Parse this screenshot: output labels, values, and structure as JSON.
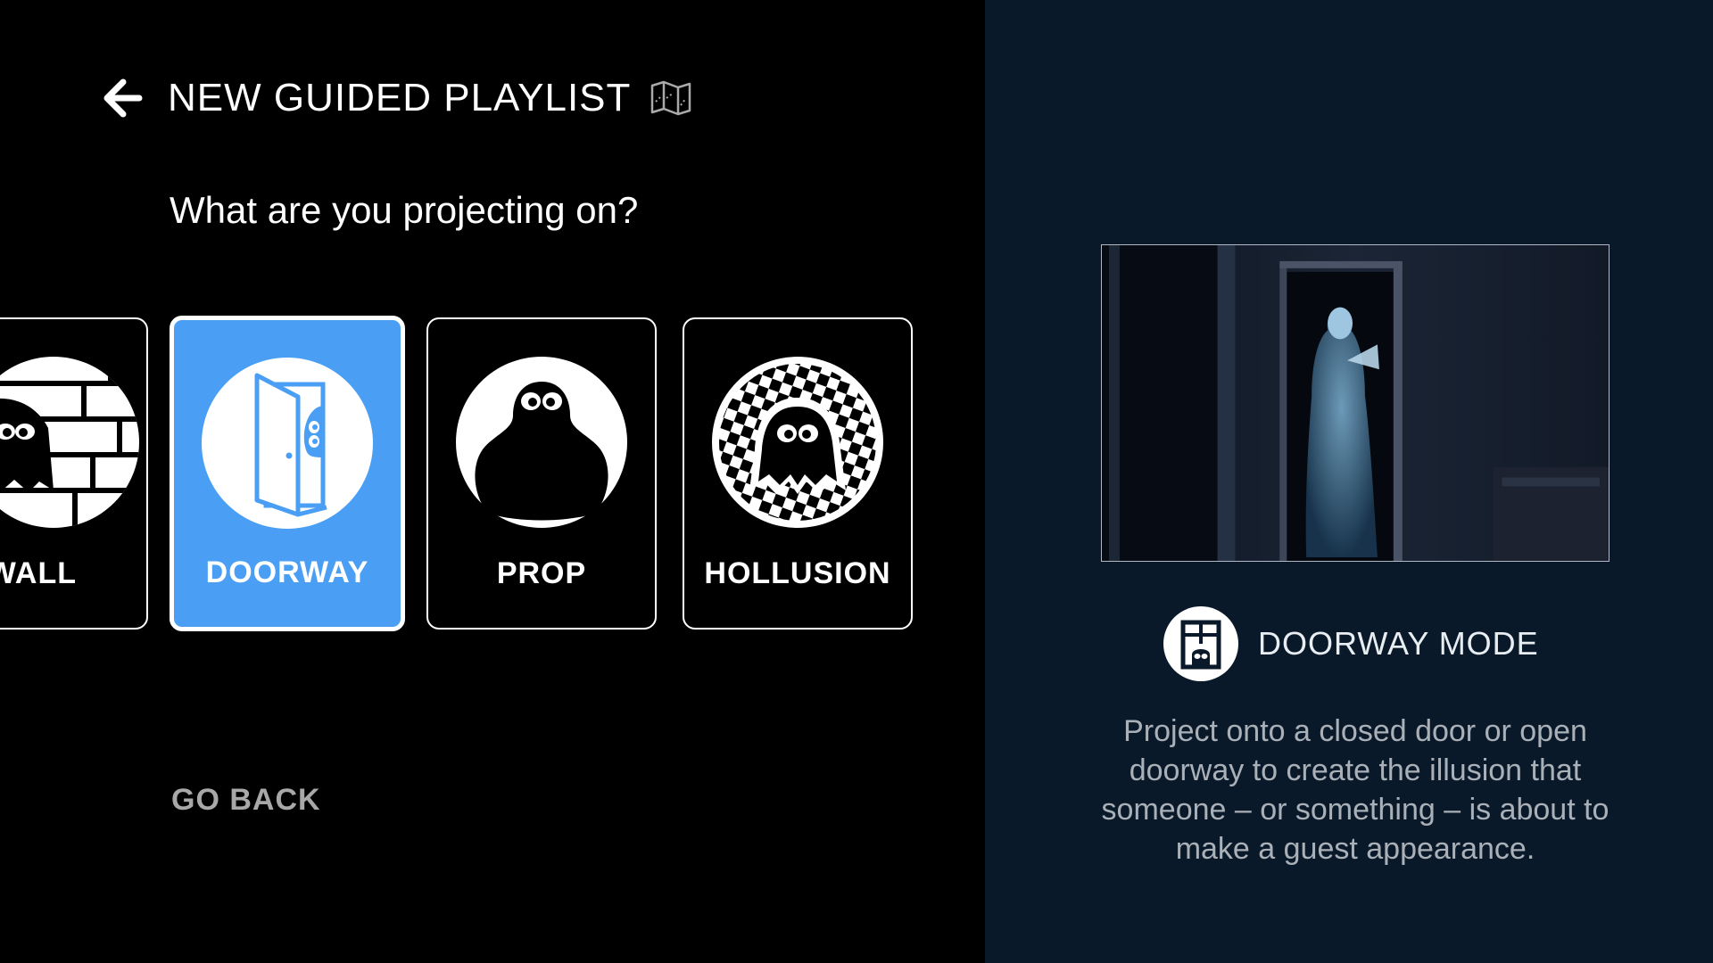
{
  "header": {
    "title": "NEW GUIDED PLAYLIST",
    "back_icon": "arrow-left-icon",
    "map_icon": "map-icon"
  },
  "question": "What are you projecting on?",
  "cards": [
    {
      "label": "WALL",
      "icon": "ghost-brick-wall-icon",
      "selected": false
    },
    {
      "label": "DOORWAY",
      "icon": "ghost-doorway-icon",
      "selected": true
    },
    {
      "label": "PROP",
      "icon": "ghost-prop-icon",
      "selected": false
    },
    {
      "label": "HOLLUSION",
      "icon": "ghost-checker-icon",
      "selected": false
    }
  ],
  "go_back": "GO BACK",
  "detail": {
    "mode_title": "DOORWAY MODE",
    "mode_icon": "doorway-mode-icon",
    "description": "Project onto a closed door or open doorway to create the illusion that someone – or something – is about to make a guest appearance."
  },
  "colors": {
    "left_bg": "#000000",
    "right_bg": "#0a1929",
    "selected_card": "#4a9ff5",
    "muted_text": "#a8a8a8"
  }
}
